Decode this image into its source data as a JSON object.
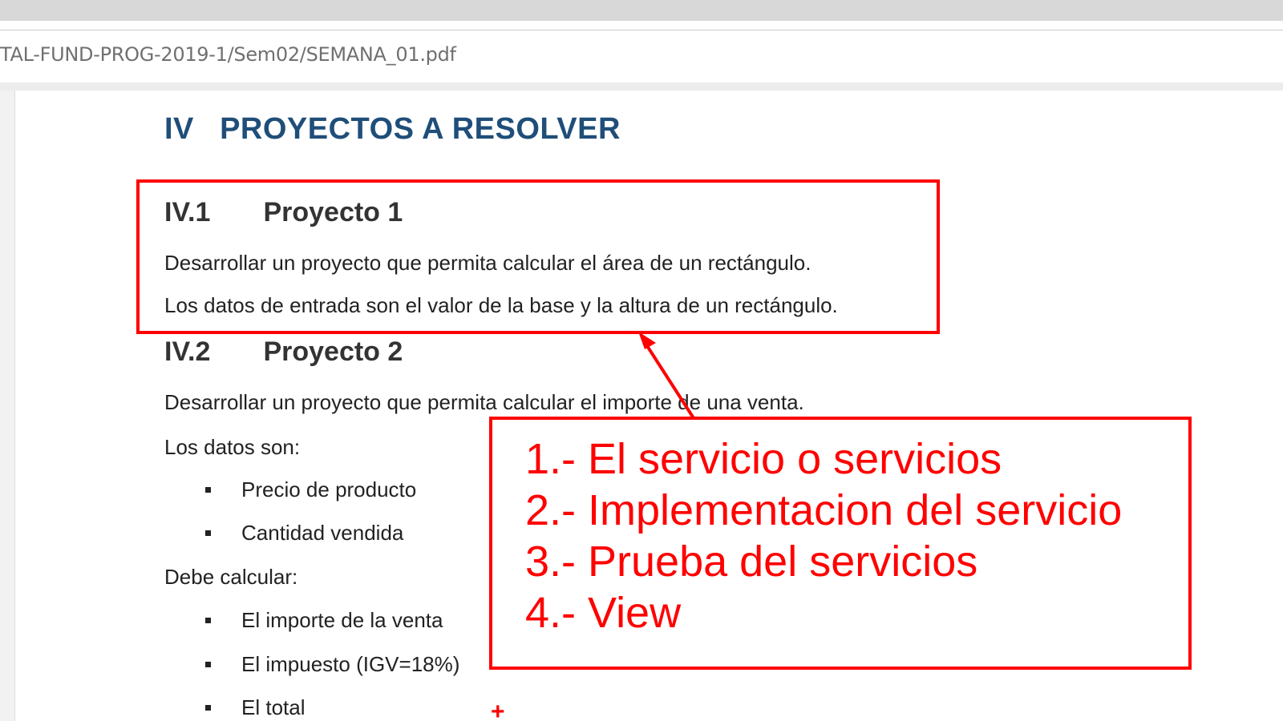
{
  "browser": {
    "url": "TAL-FUND-PROG-2019-1/Sem02/SEMANA_01.pdf"
  },
  "document": {
    "section": {
      "number": "IV",
      "title": "PROYECTOS A RESOLVER"
    },
    "project1": {
      "number": "IV.1",
      "title": "Proyecto 1",
      "line1": "Desarrollar un proyecto que permita calcular el área de un rectángulo.",
      "line2": "Los datos de entrada son el valor de la base y la altura de un rectángulo."
    },
    "project2": {
      "number": "IV.2",
      "title": "Proyecto 2",
      "line1": "Desarrollar un proyecto que permita calcular el importe de una venta.",
      "data_label": "Los datos son:",
      "data_items": [
        "Precio de producto",
        "Cantidad vendida"
      ],
      "calc_label": "Debe calcular:",
      "calc_items": [
        "El importe de la venta",
        "El impuesto (IGV=18%)",
        "El total"
      ]
    }
  },
  "annotation": {
    "items": [
      "1.- El servicio o servicios",
      "2.- Implementacion del servicio",
      "3.- Prueba del servicios",
      "4.- View"
    ],
    "cursor": "+",
    "color": "#ff0000"
  }
}
